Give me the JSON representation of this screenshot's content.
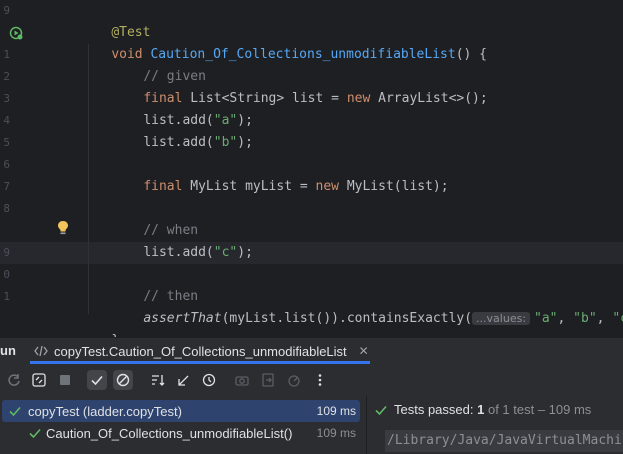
{
  "editor": {
    "gutter_numbers": [
      "9",
      "1",
      "2",
      "3",
      "4",
      "5",
      "6",
      "7",
      "8",
      "9",
      "0",
      "1",
      "2"
    ],
    "lines": {
      "l0": {
        "annotation": "@Test"
      },
      "l1": {
        "kw": "void",
        "method": "Caution_Of_Collections_unmodifiableList",
        "rest": "() {"
      },
      "l2": {
        "comment": "// given"
      },
      "l3": {
        "kw": "final",
        "a": " List<String> list = ",
        "kw2": "new",
        "b": " ArrayList<>();"
      },
      "l4": {
        "a": "list.add(",
        "str": "\"a\"",
        "b": ");"
      },
      "l5": {
        "a": "list.add(",
        "str": "\"b\"",
        "b": ");"
      },
      "l7": {
        "kw": "final",
        "a": " MyList myList = ",
        "kw2": "new",
        "b": " MyList(list);"
      },
      "l9": {
        "comment": "// when"
      },
      "l10": {
        "a": "list.add(",
        "str": "\"c\"",
        "b": ");"
      },
      "l12": {
        "comment": "// then"
      },
      "l13": {
        "it": "assertThat",
        "a": "(myList.list()).containsExactly(",
        "hint": "...values:",
        "s1": "\"a\"",
        "c1": ", ",
        "s2": "\"b\"",
        "c2": ", ",
        "s3": "\"c\"",
        "b": ");"
      },
      "l14": {
        "brace": "}"
      }
    }
  },
  "tool_window": {
    "run_label": "un",
    "tab_label": "copyTest.Caution_Of_Collections_unmodifiableList",
    "close_glyph": "✕"
  },
  "toolbar": {
    "icons": [
      "rerun-icon",
      "rerun-failed-icon",
      "stop-icon",
      "show-passed-icon",
      "show-ignored-icon",
      "sort-icon",
      "collapse-icon",
      "history-icon",
      "screenshot-icon",
      "export-icon",
      "import-icon",
      "more-icon"
    ]
  },
  "test_tree": {
    "root": {
      "label": "copyTest (ladder.copyTest)",
      "time": "109 ms"
    },
    "child": {
      "label": "Caution_Of_Collections_unmodifiableList()",
      "time": "109 ms"
    }
  },
  "status": {
    "prefix": "Tests passed: ",
    "count": "1",
    "suffix": "of 1 test – 109 ms"
  },
  "console": {
    "line": "/Library/Java/JavaVirtualMachines"
  },
  "colors": {
    "accent": "#3574f0",
    "pass_green": "#5fb865",
    "selection": "#2e436e"
  }
}
